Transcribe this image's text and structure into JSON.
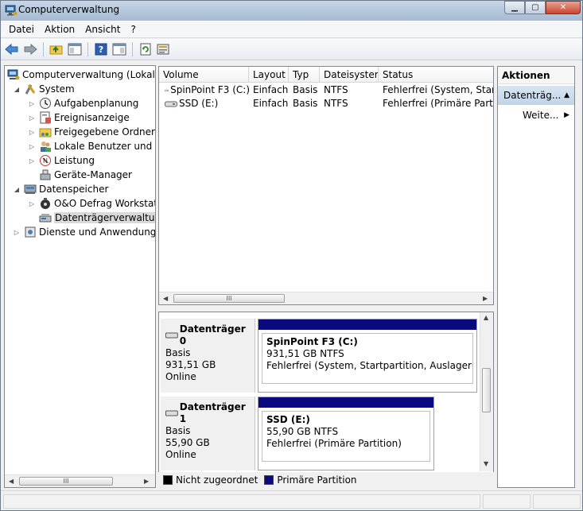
{
  "window": {
    "title": "Computerverwaltung"
  },
  "menu": {
    "items": [
      "Datei",
      "Aktion",
      "Ansicht",
      "?"
    ]
  },
  "toolbar": {
    "icons": [
      "back-arrow-icon",
      "forward-arrow-icon",
      "up-folder-icon",
      "show-tree-icon",
      "help-icon",
      "properties-icon",
      "refresh-icon",
      "export-icon"
    ]
  },
  "tree": {
    "items": [
      {
        "label": "Computerverwaltung (Lokal)",
        "icon": "computer-management-icon",
        "level": 0,
        "expander": ""
      },
      {
        "label": "System",
        "icon": "system-tools-icon",
        "level": 1,
        "expander": "expanded"
      },
      {
        "label": "Aufgabenplanung",
        "icon": "clock-icon",
        "level": 2,
        "expander": "collapsed"
      },
      {
        "label": "Ereignisanzeige",
        "icon": "event-viewer-icon",
        "level": 2,
        "expander": "collapsed"
      },
      {
        "label": "Freigegebene Ordner",
        "icon": "shared-folder-icon",
        "level": 2,
        "expander": "collapsed"
      },
      {
        "label": "Lokale Benutzer und Gru",
        "icon": "users-icon",
        "level": 2,
        "expander": "collapsed"
      },
      {
        "label": "Leistung",
        "icon": "performance-icon",
        "level": 2,
        "expander": "collapsed"
      },
      {
        "label": "Geräte-Manager",
        "icon": "device-manager-icon",
        "level": 2,
        "expander": ""
      },
      {
        "label": "Datenspeicher",
        "icon": "storage-icon",
        "level": 1,
        "expander": "expanded"
      },
      {
        "label": "O&O Defrag Workstatic",
        "icon": "defrag-icon",
        "level": 2,
        "expander": "collapsed"
      },
      {
        "label": "Datenträgerverwaltung",
        "icon": "disk-management-icon",
        "level": 2,
        "expander": "",
        "selected": true
      },
      {
        "label": "Dienste und Anwendungen",
        "icon": "services-icon",
        "level": 1,
        "expander": "collapsed"
      }
    ]
  },
  "volumes": {
    "columns": [
      "Volume",
      "Layout",
      "Typ",
      "Dateisystem",
      "Status"
    ],
    "rows": [
      {
        "volume": "SpinPoint F3 (C:)",
        "layout": "Einfach",
        "typ": "Basis",
        "fs": "NTFS",
        "status": "Fehlerfrei (System, Startpa"
      },
      {
        "volume": "SSD (E:)",
        "layout": "Einfach",
        "typ": "Basis",
        "fs": "NTFS",
        "status": "Fehlerfrei (Primäre Partitio"
      }
    ]
  },
  "disks": [
    {
      "name": "Datenträger 0",
      "type": "Basis",
      "size": "931,51 GB",
      "state": "Online",
      "partition": {
        "name": "SpinPoint F3  (C:)",
        "size": "931,51 GB NTFS",
        "status": "Fehlerfrei (System, Startpartition, Auslagerungsdat"
      }
    },
    {
      "name": "Datenträger 1",
      "type": "Basis",
      "size": "55,90 GB",
      "state": "Online",
      "partition": {
        "name": "SSD  (E:)",
        "size": "55,90 GB NTFS",
        "status": "Fehlerfrei (Primäre Partition)"
      }
    }
  ],
  "legend": {
    "unallocated": "Nicht zugeordnet",
    "primary": "Primäre Partition"
  },
  "actions": {
    "title": "Aktionen",
    "section": "Datenträg...",
    "more": "Weite..."
  },
  "scroll_grip": "III",
  "colors": {
    "primary_partition": "#0a0a80",
    "unallocated": "#000000",
    "selection": "#c1d5ea"
  }
}
